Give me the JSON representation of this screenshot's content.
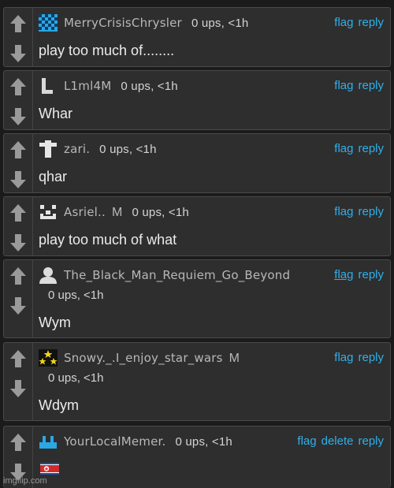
{
  "colors": {
    "background": "#1b1b1b",
    "card": "#2e2e2e",
    "link": "#2eb0ea",
    "text": "#ececec",
    "muted": "#b8b8b8"
  },
  "comments": [
    {
      "username": "MerryCrisisChrysler",
      "mod_badge": "",
      "meta": "0 ups, <1h",
      "actions": [
        "flag",
        "reply"
      ],
      "text": "play too much of........",
      "avatar": "checker-icon"
    },
    {
      "username": "L1ml4M",
      "mod_badge": "",
      "meta": "0 ups, <1h",
      "actions": [
        "flag",
        "reply"
      ],
      "text": "Whar",
      "avatar": "letter-l-icon"
    },
    {
      "username": "zari.",
      "mod_badge": "",
      "meta": "0 ups, <1h",
      "actions": [
        "flag",
        "reply"
      ],
      "text": "qhar",
      "avatar": "cross-icon"
    },
    {
      "username": "Asriel..",
      "mod_badge": "M",
      "meta": "0 ups, <1h",
      "actions": [
        "flag",
        "reply"
      ],
      "text": "play too much of what",
      "avatar": "pixel-face-icon"
    },
    {
      "username": "The_Black_Man_Requiem_Go_Beyond",
      "mod_badge": "",
      "meta": "0 ups, <1h",
      "actions": [
        "flag",
        "reply"
      ],
      "text": "Wym",
      "avatar": "default-user-icon"
    },
    {
      "username": "Snowy._.I_enjoy_star_wars",
      "mod_badge": "M",
      "meta": "0 ups, <1h",
      "actions": [
        "flag",
        "reply"
      ],
      "text": "Wdym",
      "avatar": "stars-icon"
    },
    {
      "username": "YourLocalMemer.",
      "mod_badge": "",
      "meta": "0 ups, <1h",
      "actions": [
        "flag",
        "delete",
        "reply"
      ],
      "text": "",
      "avatar": "blue-bars-icon",
      "flag_emoji": "north-korea-flag"
    }
  ],
  "watermark": "imgflip.com"
}
